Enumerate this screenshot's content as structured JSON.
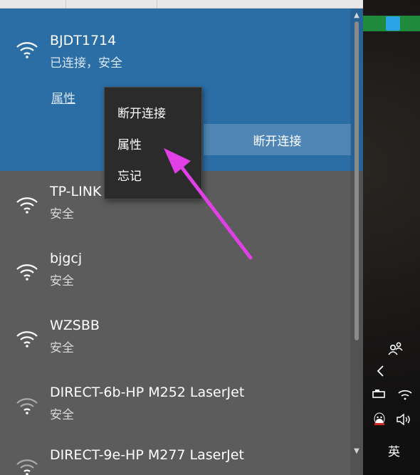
{
  "wifi_panel": {
    "connected": {
      "ssid": "BJDT1714",
      "status": "已连接，安全",
      "properties_link": "属性",
      "disconnect_button": "断开连接"
    },
    "networks": [
      {
        "ssid": "TP-LINK",
        "status": "安全"
      },
      {
        "ssid": "bjgcj",
        "status": "安全"
      },
      {
        "ssid": "WZSBB",
        "status": "安全"
      },
      {
        "ssid": "DIRECT-6b-HP M252 LaserJet",
        "status": "安全"
      },
      {
        "ssid": "DIRECT-9e-HP M277 LaserJet",
        "status": ""
      }
    ]
  },
  "context_menu": {
    "items": [
      "断开连接",
      "属性",
      "忘记"
    ]
  },
  "taskbar": {
    "ime_label": "英"
  },
  "icons": {
    "wifi": "wifi-icon",
    "people": "people-icon",
    "chevron": "chevron-left-icon",
    "volume": "volume-icon"
  },
  "colors": {
    "panel_bg": "#5c5c5c",
    "connected_bg": "#2b6ea6",
    "button_bg": "#4f86b5",
    "menu_bg": "#2b2b2b",
    "arrow": "#e040e6"
  }
}
